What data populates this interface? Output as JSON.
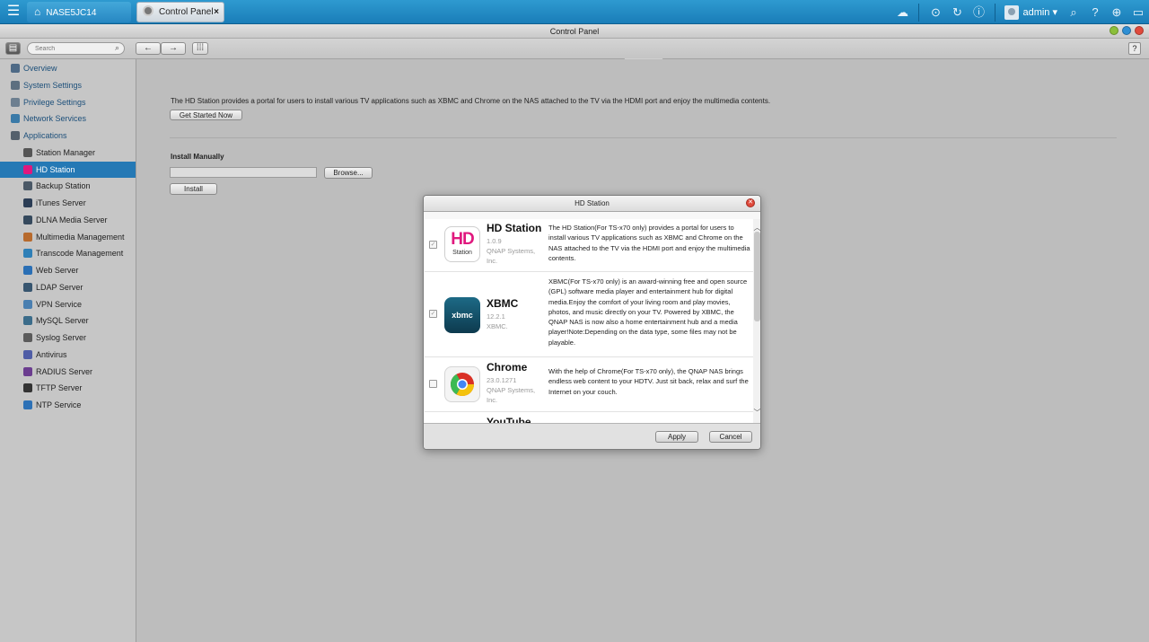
{
  "topbar": {
    "home_label": "NASE5JC14",
    "tab_label": "Control Panel",
    "user": "admin",
    "icons": [
      "cloud-icon",
      "download-icon",
      "refresh-icon",
      "info-icon",
      "avatar",
      "search-icon",
      "help-icon",
      "globe-icon",
      "monitor-icon"
    ]
  },
  "window": {
    "title": "Control Panel"
  },
  "toolbar": {
    "search_placeholder": "Search"
  },
  "sidebar": {
    "items": [
      {
        "label": "Overview",
        "level": "top"
      },
      {
        "label": "System Settings",
        "level": "top"
      },
      {
        "label": "Privilege Settings",
        "level": "top"
      },
      {
        "label": "Network Services",
        "level": "top"
      },
      {
        "label": "Applications",
        "level": "top"
      },
      {
        "label": "Station Manager",
        "level": "sub"
      },
      {
        "label": "HD Station",
        "level": "sub",
        "active": true
      },
      {
        "label": "Backup Station",
        "level": "sub"
      },
      {
        "label": "iTunes Server",
        "level": "sub"
      },
      {
        "label": "DLNA Media Server",
        "level": "sub"
      },
      {
        "label": "Multimedia Management",
        "level": "sub"
      },
      {
        "label": "Transcode Management",
        "level": "sub"
      },
      {
        "label": "Web Server",
        "level": "sub"
      },
      {
        "label": "LDAP Server",
        "level": "sub"
      },
      {
        "label": "VPN Service",
        "level": "sub"
      },
      {
        "label": "MySQL Server",
        "level": "sub"
      },
      {
        "label": "Syslog Server",
        "level": "sub"
      },
      {
        "label": "Antivirus",
        "level": "sub"
      },
      {
        "label": "RADIUS Server",
        "level": "sub"
      },
      {
        "label": "TFTP Server",
        "level": "sub"
      },
      {
        "label": "NTP Service",
        "level": "sub"
      }
    ]
  },
  "main": {
    "description": "The HD Station provides a portal for users to install various TV applications such as XBMC and Chrome on the NAS attached to the TV via the HDMI port and enjoy the multimedia contents.",
    "get_started_label": "Get Started Now",
    "install_manually_label": "Install Manually",
    "browse_label": "Browse...",
    "install_label": "Install"
  },
  "modal": {
    "title": "HD Station",
    "apply_label": "Apply",
    "cancel_label": "Cancel",
    "apps": [
      {
        "name": "HD Station",
        "version": "1.0.9",
        "vendor": "QNAP Systems, Inc.",
        "description": "The HD Station(For TS-x70 only) provides a portal for users to install various TV applications such as XBMC and Chrome on the NAS attached to the TV via the HDMI port and enjoy the multimedia contents.",
        "checked": true,
        "icon_text": "HD",
        "icon_sub": "Station"
      },
      {
        "name": "XBMC",
        "version": "12.2.1",
        "vendor": "XBMC.",
        "description": "XBMC(For TS-x70 only) is an award-winning free and open source (GPL) software media player and entertainment hub for digital media.Enjoy the comfort of your living room and play movies, photos, and music directly on your TV. Powered by XBMC, the QNAP NAS is now also a home entertainment hub and a media player!Note:Depending on the data type, some files may not be playable.",
        "checked": true,
        "icon_text": "xbmc"
      },
      {
        "name": "Chrome",
        "version": "23.0.1271",
        "vendor": "QNAP Systems, Inc.",
        "description": "With the help of Chrome(For TS-x70 only), the QNAP NAS brings endless web content to your HDTV. Just sit back, relax and surf the Internet on your couch.",
        "checked": false
      },
      {
        "name": "YouTube"
      }
    ]
  },
  "colors": {
    "topbar": "#1f86c0",
    "active_nav": "#2579b5",
    "hd_pink": "#e0187e",
    "close_red": "#e04a3c"
  }
}
